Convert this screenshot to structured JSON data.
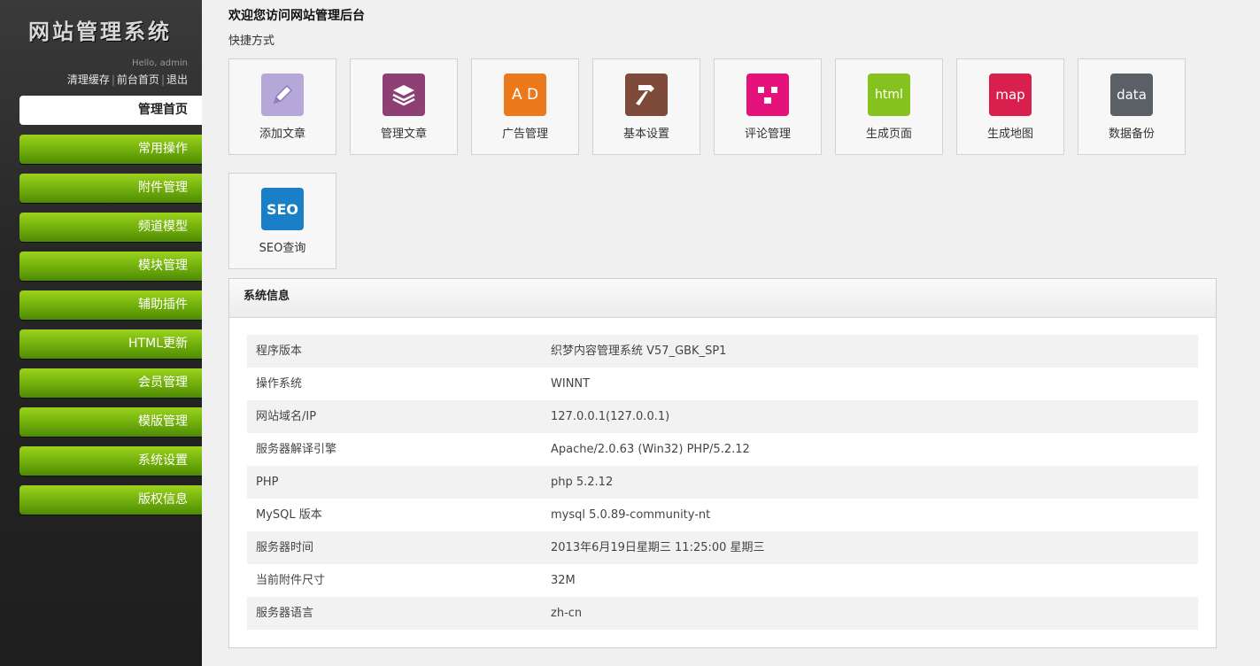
{
  "sidebar": {
    "logo": "网站管理系统",
    "hello": "Hello, admin",
    "links": [
      "清理缓存",
      "前台首页",
      "退出"
    ],
    "nav": [
      {
        "label": "管理首页",
        "active": true
      },
      {
        "label": "常用操作"
      },
      {
        "label": "附件管理"
      },
      {
        "label": "频道模型"
      },
      {
        "label": "模块管理"
      },
      {
        "label": "辅助插件"
      },
      {
        "label": "HTML更新"
      },
      {
        "label": "会员管理"
      },
      {
        "label": "模版管理"
      },
      {
        "label": "系统设置"
      },
      {
        "label": "版权信息"
      }
    ]
  },
  "main": {
    "welcome": "欢迎您访问网站管理后台",
    "quick_label": "快捷方式",
    "shortcuts": [
      {
        "label": "添加文章",
        "icon": "pencil-icon",
        "color": "#b5a8d8"
      },
      {
        "label": "管理文章",
        "icon": "documents-icon",
        "color": "#8e3f74"
      },
      {
        "label": "广告管理",
        "icon": "ad-icon",
        "icon_text": "A D",
        "color": "#ec7a1c"
      },
      {
        "label": "基本设置",
        "icon": "hammer-icon",
        "color": "#7e4a3a"
      },
      {
        "label": "评论管理",
        "icon": "comments-icon",
        "color": "#e5127b"
      },
      {
        "label": "生成页面",
        "icon": "html-icon",
        "icon_text": "html",
        "color": "#86c21e"
      },
      {
        "label": "生成地图",
        "icon": "map-icon",
        "icon_text": "map",
        "color": "#d81f4d"
      },
      {
        "label": "数据备份",
        "icon": "data-icon",
        "icon_text": "data",
        "color": "#5b6066"
      },
      {
        "label": "SEO查询",
        "icon": "seo-icon",
        "icon_text": "SEO",
        "color": "#1a7fc6"
      }
    ],
    "sysinfo": {
      "title": "系统信息",
      "rows": [
        {
          "k": "程序版本",
          "v": "织梦内容管理系统  V57_GBK_SP1"
        },
        {
          "k": "操作系统",
          "v": "WINNT"
        },
        {
          "k": "网站域名/IP",
          "v": "127.0.0.1(127.0.0.1)"
        },
        {
          "k": "服务器解译引擎",
          "v": "Apache/2.0.63 (Win32) PHP/5.2.12"
        },
        {
          "k": "PHP",
          "v": "php 5.2.12"
        },
        {
          "k": "MySQL 版本",
          "v": "mysql 5.0.89-community-nt"
        },
        {
          "k": "服务器时间",
          "v": "2013年6月19日星期三  11:25:00 星期三"
        },
        {
          "k": "当前附件尺寸",
          "v": "32M"
        },
        {
          "k": "服务器语言",
          "v": "zh-cn"
        }
      ]
    }
  }
}
